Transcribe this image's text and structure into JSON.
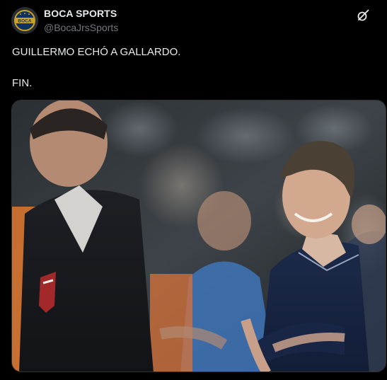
{
  "author": {
    "display_name": "BOCA SPORTS",
    "handle": "@BocaJrsSports",
    "avatar_text": "BOCA"
  },
  "tweet": {
    "line1": "GUILLERMO ECHÓ A GALLARDO.",
    "line2": "FIN."
  },
  "icons": {
    "action": "grok-icon"
  },
  "colors": {
    "background": "#000000",
    "text_primary": "#e7e9ea",
    "text_secondary": "#71767b",
    "border": "#2f3336",
    "avatar_gold": "#c9a227",
    "avatar_blue": "#10305f"
  }
}
